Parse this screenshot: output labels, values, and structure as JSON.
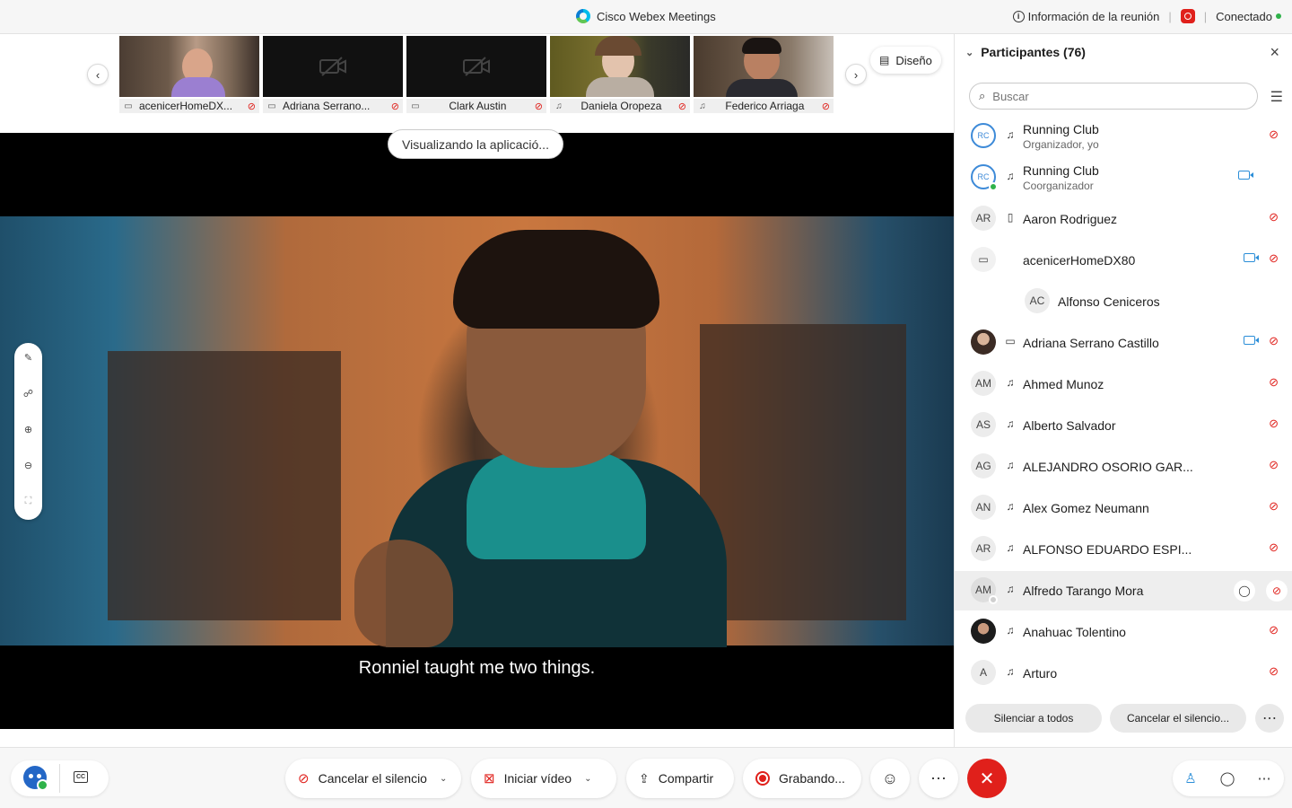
{
  "titlebar": {
    "app_title": "Cisco Webex Meetings",
    "meeting_info": "Información de la reunión",
    "status": "Conectado",
    "colors": {
      "recording": "#e0201b",
      "connected": "#2fb24a"
    }
  },
  "strip": {
    "layout_label": "Diseño",
    "thumbnails": [
      {
        "name": "acenicerHomeDX...",
        "device_icon": "device-icon",
        "muted": true,
        "camera_off": false
      },
      {
        "name": "Adriana Serrano...",
        "device_icon": "device-icon",
        "muted": true,
        "camera_off": true
      },
      {
        "name": "Clark Austin",
        "device_icon": "device-icon",
        "muted": true,
        "camera_off": true
      },
      {
        "name": "Daniela Oropeza",
        "device_icon": "headset-icon",
        "muted": true,
        "camera_off": false
      },
      {
        "name": "Federico Arriaga",
        "device_icon": "headset-icon",
        "muted": true,
        "camera_off": false
      }
    ]
  },
  "stage": {
    "viewing_label": "Visualizando la aplicació...",
    "subtitle": "Ronniel taught me two things."
  },
  "participants": {
    "title": "Participantes (76)",
    "search_placeholder": "Buscar",
    "list": [
      {
        "initials": "",
        "avatar": "logo",
        "name": "Running Club",
        "role": "Organizador, yo",
        "device": "headset-icon",
        "video": false,
        "muted": true
      },
      {
        "initials": "",
        "avatar": "logo",
        "name": "Running Club",
        "role": "Coorganizador",
        "device": "headset-icon",
        "video": true,
        "muted": false,
        "presence": true
      },
      {
        "initials": "AR",
        "avatar": "initials",
        "name": "Aaron Rodriguez",
        "role": "",
        "device": "phone-icon",
        "video": false,
        "muted": true
      },
      {
        "initials": "",
        "avatar": "device",
        "name": "acenicerHomeDX80",
        "role": "",
        "device": "",
        "video": true,
        "muted": true
      },
      {
        "initials": "AC",
        "avatar": "initials-indent",
        "name": "Alfonso Ceniceros",
        "role": "",
        "device": "",
        "video": false,
        "muted": false
      },
      {
        "initials": "",
        "avatar": "photo",
        "name": "Adriana Serrano Castillo",
        "role": "",
        "device": "device-icon",
        "video": true,
        "muted": true
      },
      {
        "initials": "AM",
        "avatar": "initials",
        "name": "Ahmed Munoz",
        "role": "",
        "device": "headset-icon",
        "video": false,
        "muted": true
      },
      {
        "initials": "AS",
        "avatar": "initials",
        "name": "Alberto Salvador",
        "role": "",
        "device": "headset-icon",
        "video": false,
        "muted": true
      },
      {
        "initials": "AG",
        "avatar": "initials",
        "name": "ALEJANDRO OSORIO GAR...",
        "role": "",
        "device": "headset-icon",
        "video": false,
        "muted": true
      },
      {
        "initials": "AN",
        "avatar": "initials",
        "name": "Alex Gomez Neumann",
        "role": "",
        "device": "headset-icon",
        "video": false,
        "muted": true
      },
      {
        "initials": "AR",
        "avatar": "initials",
        "name": "ALFONSO EDUARDO ESPI...",
        "role": "",
        "device": "headset-icon",
        "video": false,
        "muted": true
      },
      {
        "initials": "AM",
        "avatar": "initials",
        "name": "Alfredo Tarango Mora",
        "role": "",
        "device": "headset-icon",
        "video": false,
        "muted": true,
        "highlighted": true
      },
      {
        "initials": "",
        "avatar": "photo",
        "name": "Anahuac Tolentino",
        "role": "",
        "device": "headset-icon",
        "video": false,
        "muted": true
      },
      {
        "initials": "A",
        "avatar": "initials",
        "name": "Arturo",
        "role": "",
        "device": "headset-icon",
        "video": false,
        "muted": true
      }
    ],
    "mute_all": "Silenciar a todos",
    "unmute_all": "Cancelar el silencio..."
  },
  "controls": {
    "unmute": "Cancelar el silencio",
    "start_video": "Iniciar vídeo",
    "share": "Compartir",
    "recording": "Grabando..."
  }
}
